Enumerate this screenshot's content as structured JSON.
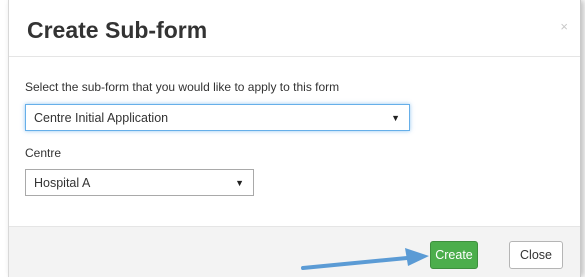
{
  "dialog": {
    "title": "Create Sub-form",
    "close_glyph": "×"
  },
  "form": {
    "subform_label": "Select the sub-form that you would like to apply to this form",
    "subform_value": "Centre Initial Application",
    "centre_label": "Centre",
    "centre_value": "Hospital A",
    "caret_glyph": "▼"
  },
  "footer": {
    "create_label": "Create",
    "close_label": "Close"
  },
  "colors": {
    "create_button": "#4cae4c",
    "arrow": "#5b9bd5",
    "focus_ring": "#66afe9"
  }
}
